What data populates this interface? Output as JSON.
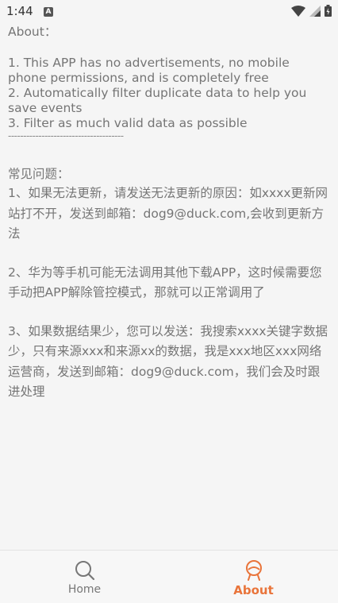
{
  "status_bar": {
    "time": "1:44",
    "notification_badge": "A"
  },
  "content": {
    "about_heading": "About：",
    "features": [
      "1. This APP has no advertisements, no mobile phone permissions, and is completely free",
      "2. Automatically filter duplicate data to help you save events",
      "3. Filter as much valid data as possible"
    ],
    "divider": "--------------------------------------",
    "faq_heading": "常见问题：",
    "faq": [
      "1、如果无法更新，请发送无法更新的原因：如xxxx更新网站打不开，发送到邮箱：dog9@duck.com,会收到更新方法",
      "2、华为等手机可能无法调用其他下载APP，这时候需要您手动把APP解除管控模式，那就可以正常调用了",
      "3、如果数据结果少，您可以发送：我搜索xxxx关键字数据少，只有来源xxx和来源xx的数据，我是xxx地区xxx网络运营商，发送到邮箱：dog9@duck.com，我们会及时跟进处理"
    ]
  },
  "tabbar": {
    "home_label": "Home",
    "about_label": "About",
    "active_color": "#e9743a",
    "inactive_color": "#777777"
  }
}
